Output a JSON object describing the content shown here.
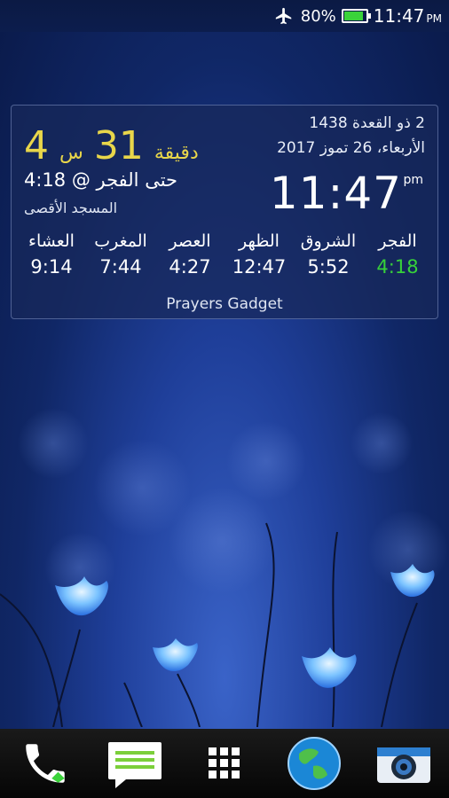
{
  "status": {
    "battery": "80%",
    "time": "11:47",
    "ampm": "PM"
  },
  "widget": {
    "hijri_date": "2 ذو القعدة 1438",
    "gregorian_date": "الأربعاء، 26 تموز 2017",
    "clock": "11:47",
    "clock_ampm": "pm",
    "countdown": {
      "hours": "4",
      "hours_unit": "س",
      "minutes": "31",
      "minutes_unit": "دقيقة"
    },
    "until_text": "حتى الفجر @ 4:18",
    "location": "المسجد الأقصى",
    "prayers": [
      {
        "name": "العشاء",
        "time": "9:14"
      },
      {
        "name": "المغرب",
        "time": "7:44"
      },
      {
        "name": "العصر",
        "time": "4:27"
      },
      {
        "name": "الظهر",
        "time": "12:47"
      },
      {
        "name": "الشروق",
        "time": "5:52"
      },
      {
        "name": "الفجر",
        "time": "4:18"
      }
    ],
    "footer": "Prayers Gadget",
    "next_color": "#37d13a",
    "countdown_color": "#e8d64a"
  },
  "dock": [
    "phone-icon",
    "messages-icon",
    "app-drawer-icon",
    "browser-globe-icon",
    "camera-icon"
  ]
}
